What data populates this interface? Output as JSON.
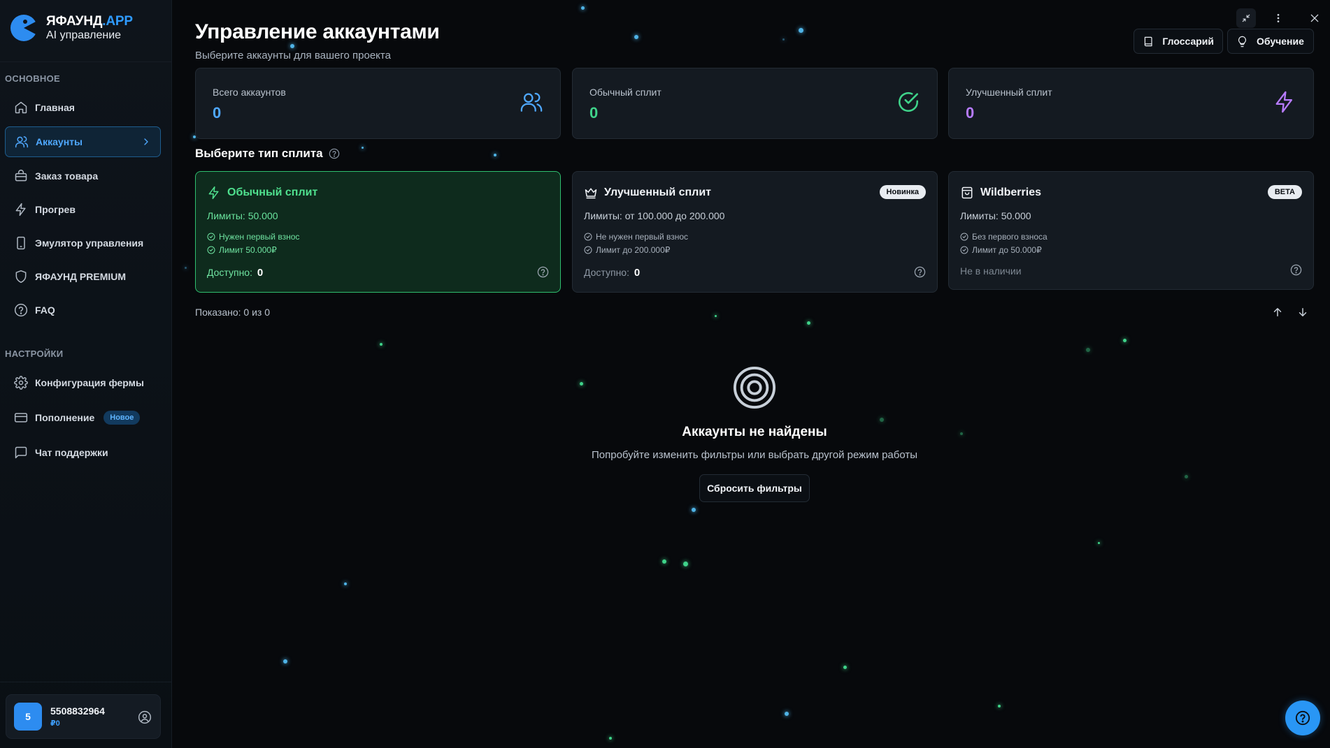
{
  "brand": {
    "name_main": "ЯФАУНД",
    "name_accent": ".APP",
    "subtitle": "AI управление"
  },
  "sidebar": {
    "section_main": "ОСНОВНОЕ",
    "section_settings": "НАСТРОЙКИ",
    "items": [
      {
        "label": "Главная",
        "icon": "home-icon"
      },
      {
        "label": "Аккаунты",
        "icon": "users-icon",
        "active": true
      },
      {
        "label": "Заказ товара",
        "icon": "bag-icon"
      },
      {
        "label": "Прогрев",
        "icon": "bolt-icon"
      },
      {
        "label": "Эмулятор управления",
        "icon": "phone-icon"
      },
      {
        "label": "ЯФАУНД PREMIUM",
        "icon": "shield-icon"
      },
      {
        "label": "FAQ",
        "icon": "help-icon"
      },
      {
        "label": "Конфигурация фермы",
        "icon": "gear-icon"
      },
      {
        "label": "Пополнение",
        "icon": "card-icon",
        "badge": "Новое"
      },
      {
        "label": "Чат поддержки",
        "icon": "chat-icon"
      }
    ],
    "user": {
      "avatar_letter": "5",
      "id": "5508832964",
      "balance": "₽0"
    }
  },
  "header": {
    "title": "Управление аккаунтами",
    "subtitle": "Выберите аккаунты для вашего проекта",
    "glossary_label": "Глоссарий",
    "learn_label": "Обучение"
  },
  "stats": [
    {
      "label": "Всего аккаунтов",
      "value": "0",
      "color": "#4fa8ff",
      "icon": "users-icon"
    },
    {
      "label": "Обычный сплит",
      "value": "0",
      "color": "#3fd38a",
      "icon": "check-circle-icon"
    },
    {
      "label": "Улучшенный сплит",
      "value": "0",
      "color": "#b77bff",
      "icon": "bolt-icon"
    }
  ],
  "split_section": {
    "title": "Выберите тип сплита",
    "cards": [
      {
        "title": "Обычный сплит",
        "limits": "Лимиты: 50.000",
        "features": [
          "Нужен первый взнос",
          "Лимит 50.000₽"
        ],
        "available_label": "Доступно:",
        "available_value": "0",
        "selected": true
      },
      {
        "title": "Улучшенный сплит",
        "badge": "Новинка",
        "limits": "Лимиты: от 100.000 до 200.000",
        "features": [
          "Не нужен первый взнос",
          "Лимит до 200.000₽"
        ],
        "available_label": "Доступно:",
        "available_value": "0"
      },
      {
        "title": "Wildberries",
        "badge": "BETA",
        "limits": "Лимиты: 50.000",
        "features": [
          "Без первого взноса",
          "Лимит до 50.000₽"
        ],
        "status": "Не в наличии"
      }
    ]
  },
  "list": {
    "shown": "Показано: 0 из 0"
  },
  "empty": {
    "title": "Аккаунты не найдены",
    "description": "Попробуйте изменить фильтры или выбрать другой режим работы",
    "reset_label": "Сбросить фильтры"
  },
  "colors": {
    "accent": "#2f9bff",
    "success": "#3fd38a",
    "purple": "#b77bff",
    "background": "#07090c"
  }
}
